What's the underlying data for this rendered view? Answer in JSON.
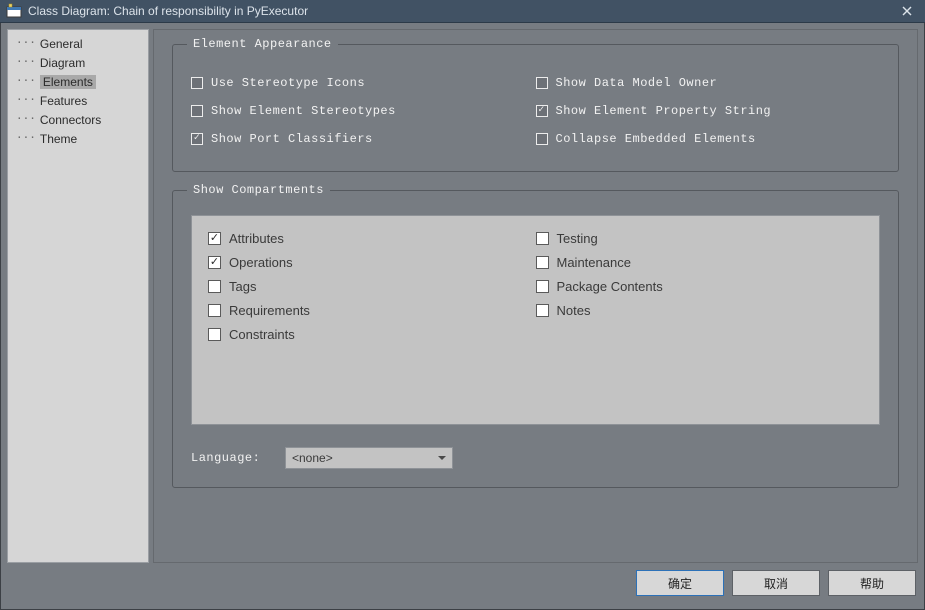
{
  "window": {
    "title": "Class Diagram: Chain of responsibility in PyExecutor"
  },
  "sidebar": {
    "items": [
      {
        "label": "General",
        "selected": false
      },
      {
        "label": "Diagram",
        "selected": false
      },
      {
        "label": "Elements",
        "selected": true
      },
      {
        "label": "Features",
        "selected": false
      },
      {
        "label": "Connectors",
        "selected": false
      },
      {
        "label": "Theme",
        "selected": false
      }
    ]
  },
  "content": {
    "group_appearance": {
      "legend": "Element Appearance",
      "left": [
        {
          "label": "Use Stereotype Icons",
          "checked": false
        },
        {
          "label": "Show Element Stereotypes",
          "checked": false
        },
        {
          "label": "Show Port Classifiers",
          "checked": true
        }
      ],
      "right": [
        {
          "label": "Show Data Model Owner",
          "checked": false
        },
        {
          "label": "Show Element Property String",
          "checked": true
        },
        {
          "label": "Collapse Embedded Elements",
          "checked": false
        }
      ]
    },
    "group_compartments": {
      "legend": "Show Compartments",
      "left": [
        {
          "label": "Attributes",
          "checked": true
        },
        {
          "label": "Operations",
          "checked": true
        },
        {
          "label": "Tags",
          "checked": false
        },
        {
          "label": "Requirements",
          "checked": false
        },
        {
          "label": "Constraints",
          "checked": false
        }
      ],
      "right": [
        {
          "label": "Testing",
          "checked": false
        },
        {
          "label": "Maintenance",
          "checked": false
        },
        {
          "label": "Package Contents",
          "checked": false
        },
        {
          "label": "Notes",
          "checked": false
        }
      ],
      "language_label": "Language:",
      "language_value": "<none>"
    }
  },
  "buttons": {
    "ok": "确定",
    "cancel": "取消",
    "help": "帮助"
  }
}
